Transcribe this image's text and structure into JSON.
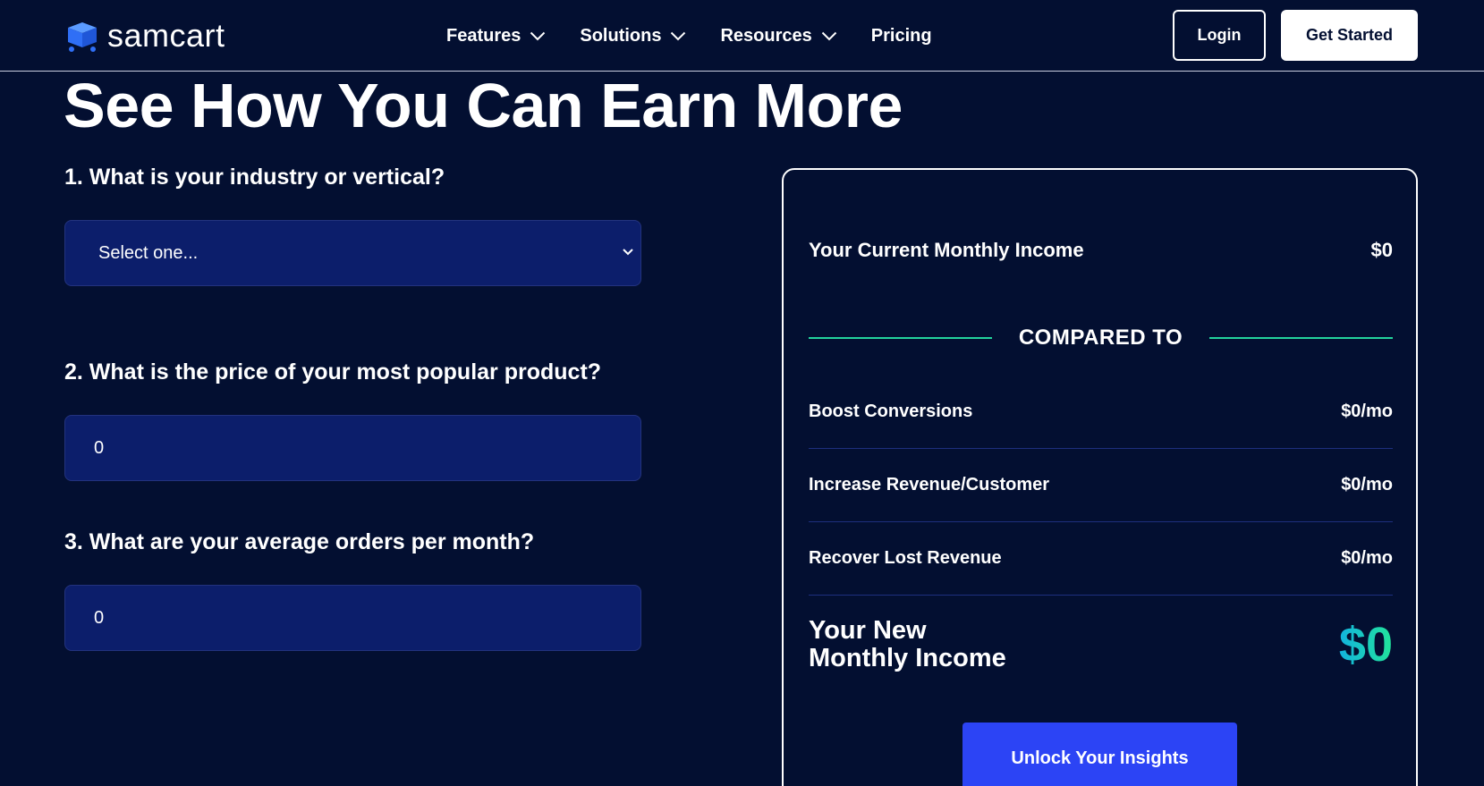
{
  "header": {
    "brand": "samcart",
    "nav": [
      {
        "label": "Features",
        "has_dropdown": true
      },
      {
        "label": "Solutions",
        "has_dropdown": true
      },
      {
        "label": "Resources",
        "has_dropdown": true
      },
      {
        "label": "Pricing",
        "has_dropdown": false
      }
    ],
    "login_label": "Login",
    "get_started_label": "Get Started"
  },
  "hero": {
    "title": "See How You Can Earn More"
  },
  "form": {
    "q1": "1. What is your industry or vertical?",
    "q1_select_value": "Select one...",
    "q2": "2. What is the price of your most popular product?",
    "q2_value": "0",
    "q3": "3. What are your average orders per month?",
    "q3_value": "0"
  },
  "results": {
    "current_label": "Your Current Monthly Income",
    "current_value": "$0",
    "compared_to": "COMPARED TO",
    "items": [
      {
        "label": "Boost Conversions",
        "value": "$0/mo"
      },
      {
        "label": "Increase Revenue/Customer",
        "value": "$0/mo"
      },
      {
        "label": "Recover Lost Revenue",
        "value": "$0/mo"
      }
    ],
    "new_label_line1": "Your New",
    "new_label_line2": "Monthly Income",
    "new_value": "$0",
    "unlock_label": "Unlock Your Insights"
  },
  "icons": {
    "logo": "cart-icon",
    "dropdown": "chevron-down-icon"
  },
  "colors": {
    "background": "#030f31",
    "field_bg": "#0c1e6b",
    "accent_green": "#22d39d",
    "accent_cyan": "#12b3df",
    "button_blue": "#2c44f5",
    "logo_blue": "#2f6ff6"
  }
}
